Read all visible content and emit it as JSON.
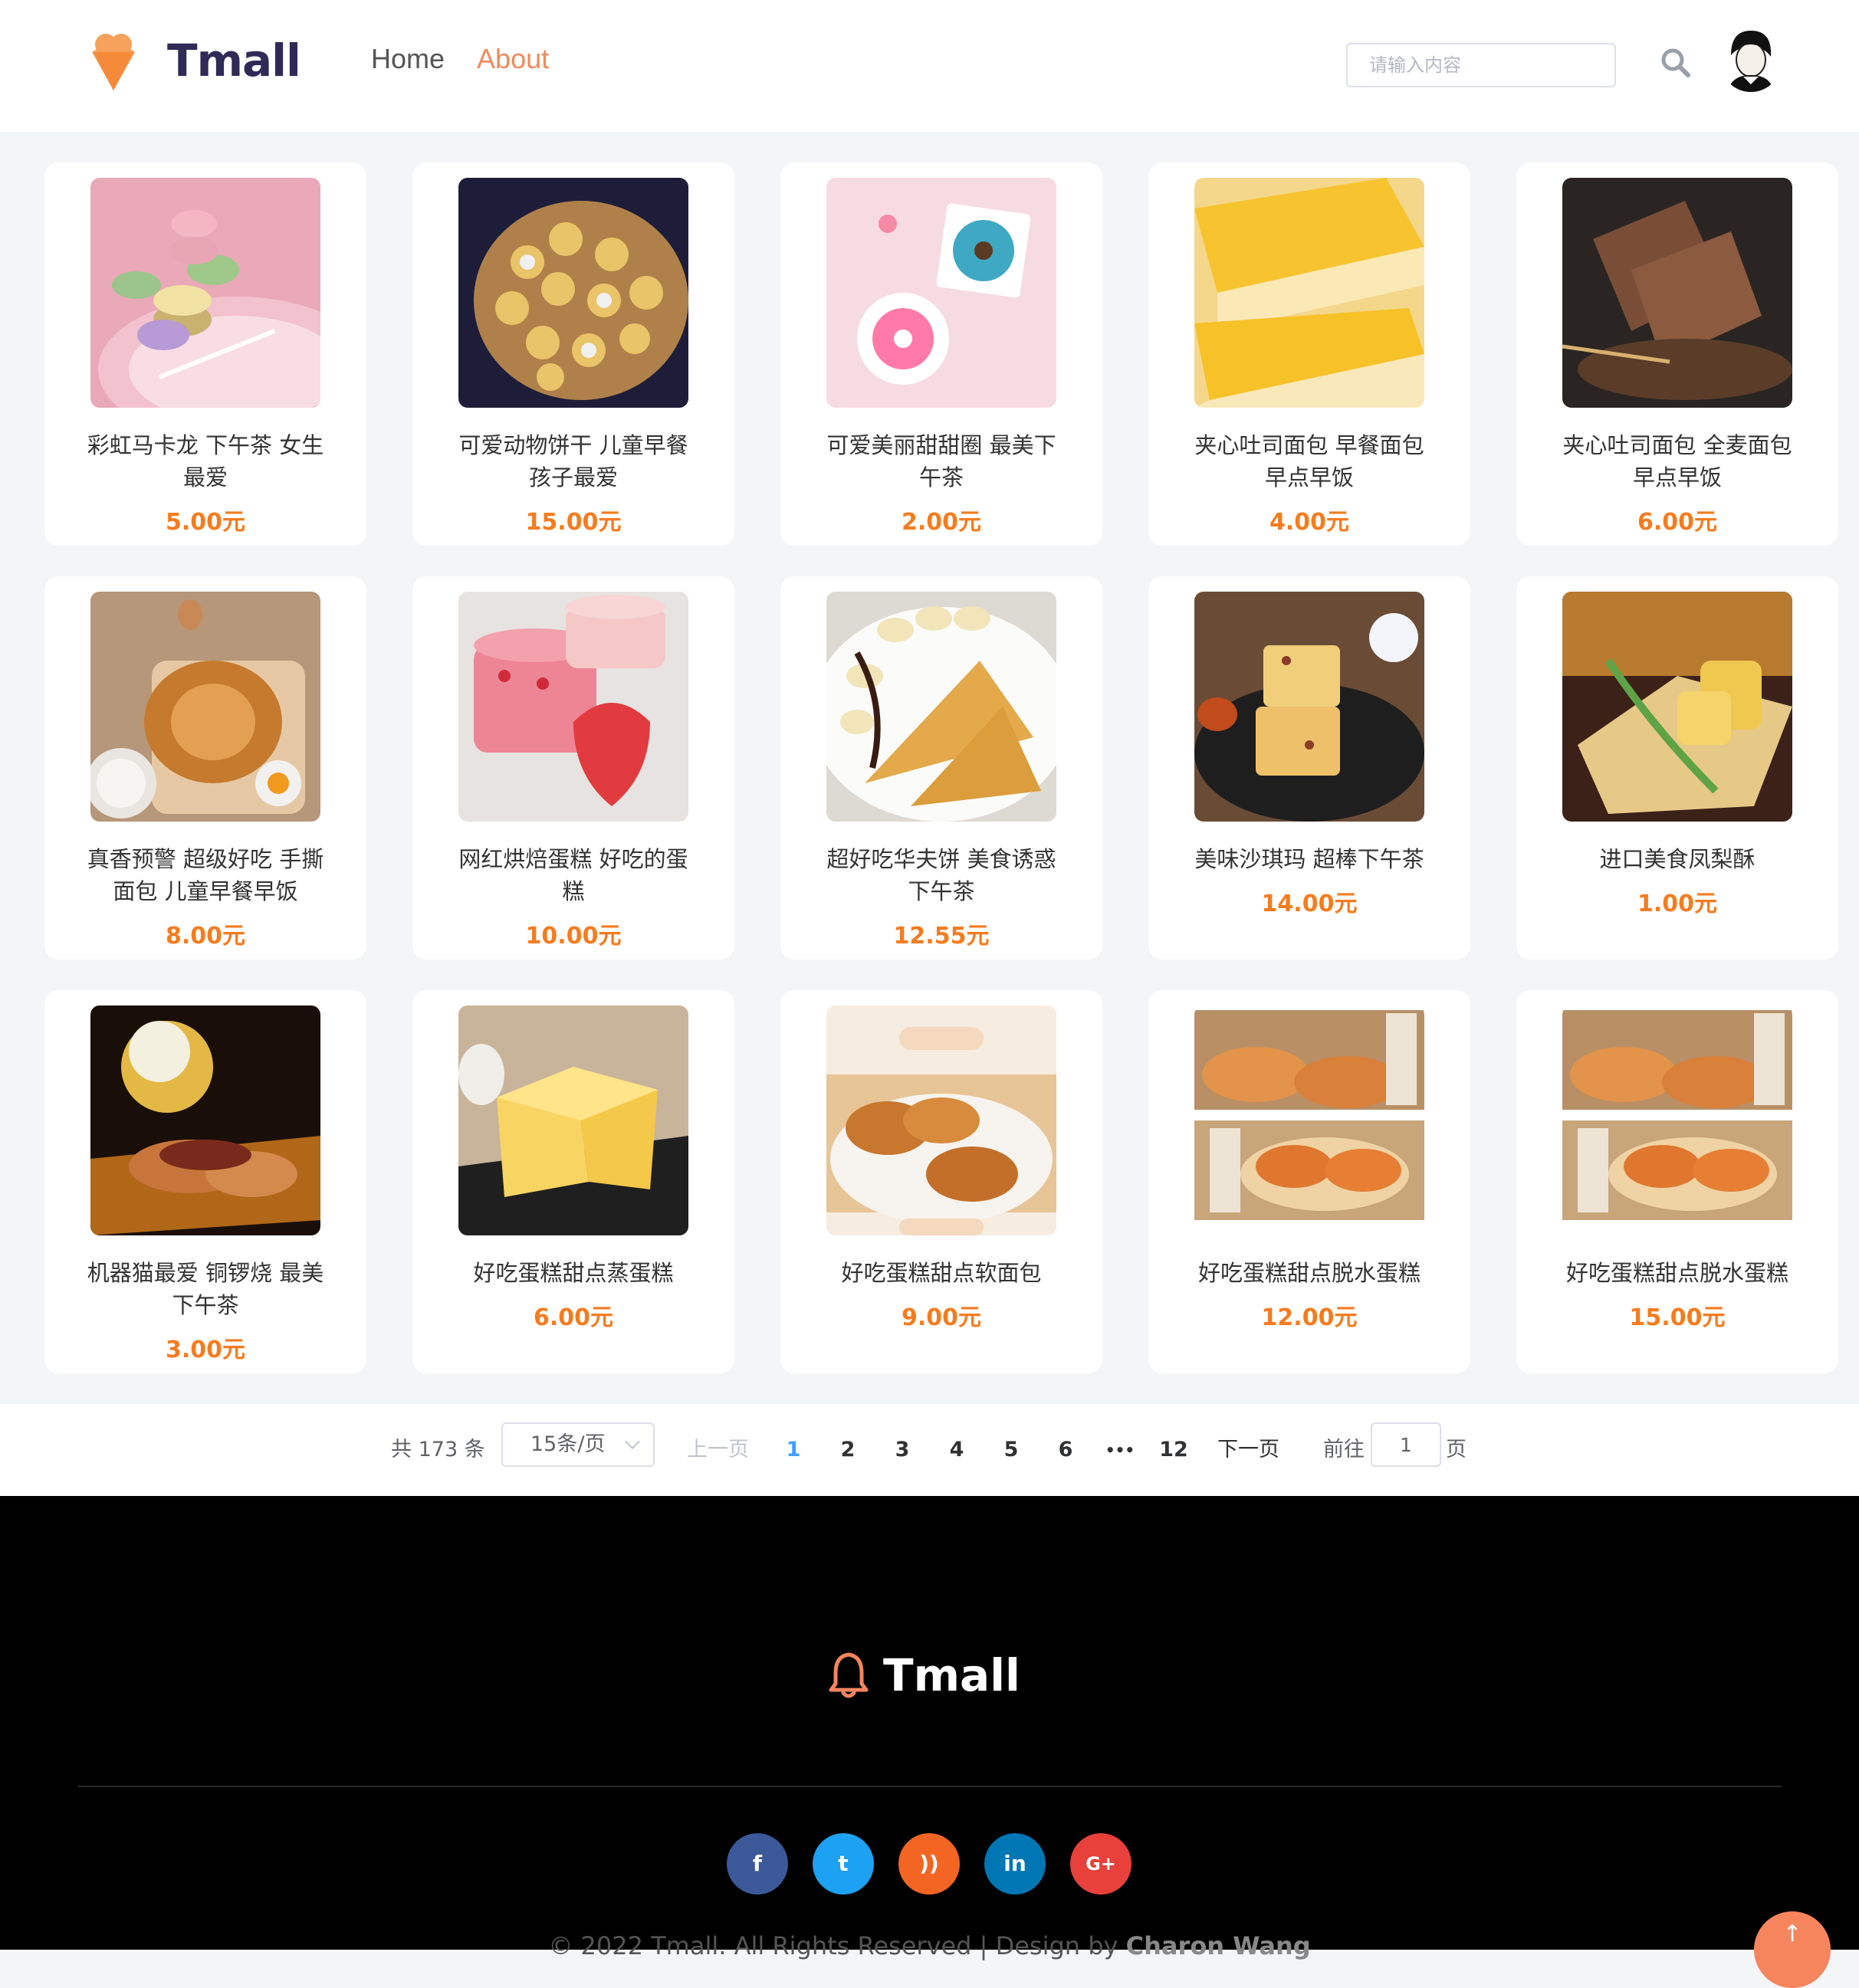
{
  "header": {
    "logo_text": "Tmall",
    "nav": [
      {
        "label": "Home",
        "active": false
      },
      {
        "label": "About",
        "active": true
      }
    ],
    "search_placeholder": "请输入内容"
  },
  "products": [
    {
      "name": "彩虹马卡龙 下午茶 女生最爱",
      "price": "5.00元"
    },
    {
      "name": "可爱动物饼干 儿童早餐 孩子最爱",
      "price": "15.00元"
    },
    {
      "name": "可爱美丽甜甜圈 最美下午茶",
      "price": "2.00元"
    },
    {
      "name": "夹心吐司面包 早餐面包 早点早饭",
      "price": "4.00元"
    },
    {
      "name": "夹心吐司面包 全麦面包 早点早饭",
      "price": "6.00元"
    },
    {
      "name": "真香预警 超级好吃 手撕面包 儿童早餐早饭",
      "price": "8.00元"
    },
    {
      "name": "网红烘焙蛋糕 好吃的蛋糕",
      "price": "10.00元"
    },
    {
      "name": "超好吃华夫饼 美食诱惑 下午茶",
      "price": "12.55元"
    },
    {
      "name": "美味沙琪玛 超棒下午茶",
      "price": "14.00元"
    },
    {
      "name": "进口美食凤梨酥",
      "price": "1.00元"
    },
    {
      "name": "机器猫最爱 铜锣烧 最美下午茶",
      "price": "3.00元"
    },
    {
      "name": "好吃蛋糕甜点蒸蛋糕",
      "price": "6.00元"
    },
    {
      "name": "好吃蛋糕甜点软面包",
      "price": "9.00元"
    },
    {
      "name": "好吃蛋糕甜点脱水蛋糕",
      "price": "12.00元"
    },
    {
      "name": "好吃蛋糕甜点脱水蛋糕",
      "price": "15.00元"
    }
  ],
  "pagination": {
    "total": "共 173 条",
    "page_size": "15条/页",
    "prev": "上一页",
    "pages": [
      "1",
      "2",
      "3",
      "4",
      "5",
      "6",
      "•••",
      "12"
    ],
    "current": "1",
    "next": "下一页",
    "goto_label": "前往",
    "goto_value": "1",
    "goto_suffix": "页"
  },
  "footer": {
    "logo_text": "Tmall",
    "social": [
      {
        "icon": "facebook-icon",
        "glyph": "f",
        "color": "#3b5998"
      },
      {
        "icon": "twitter-icon",
        "glyph": "t",
        "color": "#1da1f2"
      },
      {
        "icon": "rss-icon",
        "glyph": "))",
        "color": "#f26522"
      },
      {
        "icon": "linkedin-icon",
        "glyph": "in",
        "color": "#0077b5"
      },
      {
        "icon": "google-plus-icon",
        "glyph": "G+",
        "color": "#e8403a"
      }
    ],
    "copyright_prefix": "© 2022 Tmall. All Rights Reserved | Design by",
    "copyright_author": "Charon Wang"
  },
  "colors": {
    "accent": "#f08a5d",
    "price": "#f47c20",
    "page_active": "#409eff"
  }
}
